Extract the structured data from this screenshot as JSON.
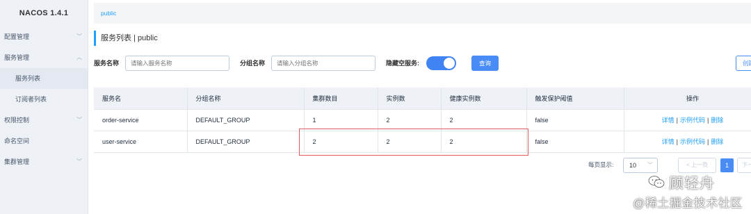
{
  "app": {
    "logo": "NACOS 1.4.1"
  },
  "sidebar": {
    "items": [
      {
        "label": "配置管理",
        "chevron": "﹀"
      },
      {
        "label": "服务管理",
        "chevron": "︿"
      },
      {
        "label": "服务列表"
      },
      {
        "label": "订阅者列表"
      },
      {
        "label": "权限控制",
        "chevron": "﹀"
      },
      {
        "label": "命名空间"
      },
      {
        "label": "集群管理",
        "chevron": "﹀"
      }
    ]
  },
  "breadcrumb": "public",
  "page_title": "服务列表 | public",
  "filters": {
    "service_label": "服务名称",
    "service_placeholder": "请输入服务名称",
    "group_label": "分组名称",
    "group_placeholder": "请输入分组名称",
    "hide_empty_label": "隐藏空服务:",
    "hide_empty_on": true,
    "query_button": "查询",
    "create_button": "创建"
  },
  "table": {
    "columns": [
      "服务名",
      "分组名称",
      "集群数目",
      "实例数",
      "健康实例数",
      "触发保护阈值",
      "操作"
    ],
    "rows": [
      {
        "service": "order-service",
        "group": "DEFAULT_GROUP",
        "clusters": "1",
        "instances": "2",
        "healthy": "2",
        "threshold": "false"
      },
      {
        "service": "user-service",
        "group": "DEFAULT_GROUP",
        "clusters": "2",
        "instances": "2",
        "healthy": "2",
        "threshold": "false"
      }
    ],
    "actions": {
      "detail": "详情",
      "sample": "示例代码",
      "delete": "删除",
      "separator": "|"
    }
  },
  "pagination": {
    "per_page_label": "每页显示:",
    "per_page_value": "10",
    "prev": "< 上一页",
    "current_page": "1",
    "next": "下一"
  },
  "watermark": {
    "line1": "顾轻舟",
    "line2": "@稀土掘金技术社区"
  },
  "colors": {
    "accent": "#20a0ff",
    "primary_button": "#4a8cf6",
    "highlight_box": "#e05a5a"
  }
}
